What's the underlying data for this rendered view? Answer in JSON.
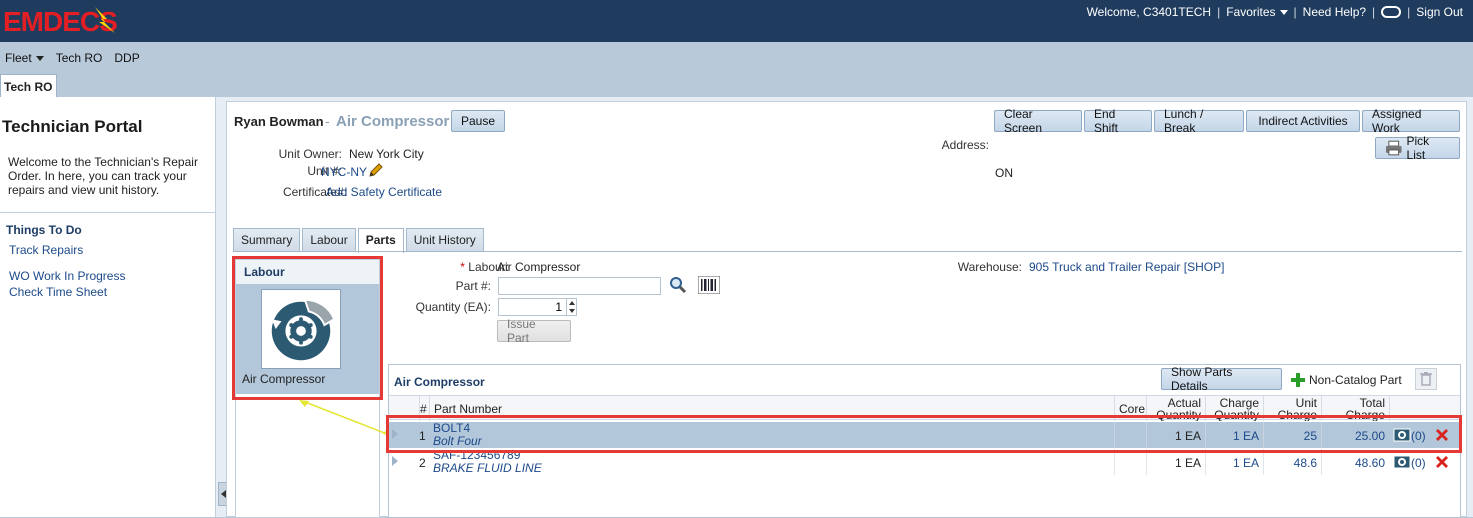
{
  "topbar": {
    "logo_text": "EMDECS",
    "welcome": "Welcome, C3401TECH",
    "favorites": "Favorites",
    "help": "Need Help?",
    "signout": "Sign Out"
  },
  "menubar": {
    "items": [
      "Fleet",
      "Tech RO",
      "DDP"
    ]
  },
  "page_tab": "Tech RO",
  "sidebar": {
    "title": "Technician Portal",
    "description": "Welcome to the Technician's Repair Order. In here, you can track your repairs and view unit history.",
    "todo_title": "Things To Do",
    "links": [
      "Track Repairs",
      "WO Work In Progress",
      "Check Time Sheet"
    ]
  },
  "header": {
    "tech_name": "Ryan Bowman",
    "dash": "-",
    "unit_name": "Air Compressor",
    "pause_label": "Pause",
    "actions": [
      "Clear Screen",
      "End Shift",
      "Lunch / Break",
      "Indirect Activities",
      "Assigned Work"
    ],
    "pick_list_label": "Pick List"
  },
  "unit_info": {
    "owner_label": "Unit Owner:",
    "owner_value": "New York City",
    "unit_label": "Unit #:",
    "unit_value": "NYC-NY",
    "cert_label": "Certificate#:",
    "cert_value": "Add Safety Certificate",
    "address_label": "Address:",
    "address_value": "ON"
  },
  "tabs": [
    "Summary",
    "Labour",
    "Parts",
    "Unit History"
  ],
  "active_tab": "Parts",
  "labour_panel": {
    "title": "Labour",
    "tile_label": "Air Compressor"
  },
  "parts_form": {
    "labour_label": "Labour:",
    "labour_value": "Air Compressor",
    "part_label": "Part #:",
    "part_value": "",
    "qty_label": "Quantity (EA):",
    "qty_value": "1",
    "issue_label": "Issue Part",
    "warehouse_label": "Warehouse:",
    "warehouse_value": "905 Truck and Trailer Repair [SHOP]"
  },
  "grid": {
    "title": "Air Compressor",
    "show_details_label": "Show Parts Details",
    "non_catalog_label": "Non-Catalog Part",
    "columns": [
      "#",
      "Part Number",
      "Core",
      "Actual Quantity",
      "Charge Quantity",
      "Unit Charge",
      "Total Charge"
    ],
    "rows": [
      {
        "num": "1",
        "part": "BOLT4",
        "desc": "Bolt Four",
        "core": "",
        "actual_qty": "1 EA",
        "charge_qty": "1 EA",
        "unit_charge": "25",
        "total_charge": "25.00",
        "attach": "(0)"
      },
      {
        "num": "2",
        "part": "SAF-123456789",
        "desc": "BRAKE FLUID LINE",
        "core": "",
        "actual_qty": "1 EA",
        "charge_qty": "1 EA",
        "unit_charge": "48.6",
        "total_charge": "48.60",
        "attach": "(0)"
      }
    ]
  },
  "colors": {
    "topbar": "#1f3c5e",
    "logo": "#e31e24",
    "highlight": "#e53935",
    "selected_row": "#b3c7da"
  }
}
